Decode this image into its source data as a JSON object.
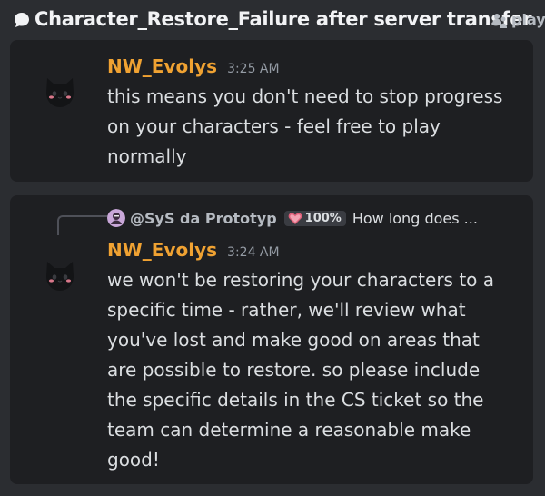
{
  "header": {
    "thread_icon": "chat-bubble-icon",
    "title": "Character_Restore_Failure after server transfer",
    "tag_icon": "players-icon",
    "tag_label": "playe"
  },
  "messages": [
    {
      "avatar": "black-cat-avatar",
      "username": "NW_Evolys",
      "timestamp": "3:25 AM",
      "lines": [
        "this means you don't need to stop progress",
        "on your characters - feel free to play",
        "normally"
      ]
    },
    {
      "avatar": "black-cat-avatar",
      "reply": {
        "username": "@SyS da Prototyp",
        "badge": "100%",
        "badge_icon": "heart-icon",
        "text": "How long does ..."
      },
      "username": "NW_Evolys",
      "timestamp": "3:24 AM",
      "lines": [
        "we won't be restoring your characters to a",
        "specific time - rather, we'll review what",
        "you've lost and make good on areas that",
        "are possible to restore. so please include",
        "the specific details in the CS ticket so the",
        "team can determine a reasonable make",
        "good!"
      ]
    }
  ],
  "colors": {
    "background": "#2b2d31",
    "card": "#1e1f22",
    "username": "#f0a232",
    "timestamp": "#949ba4",
    "text": "#dbdee1"
  }
}
